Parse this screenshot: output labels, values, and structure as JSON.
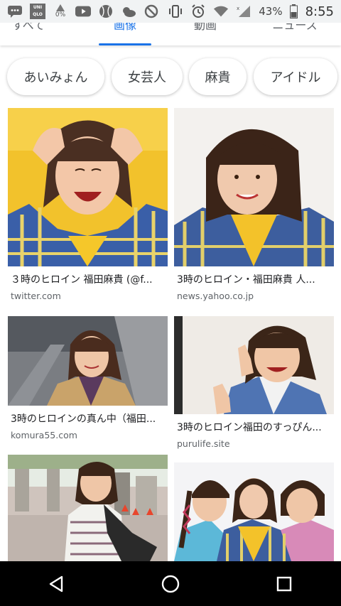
{
  "status_bar": {
    "brand_text": [
      "UNI",
      "QLO"
    ],
    "small_percent": "0%",
    "battery_percent": "43%",
    "time": "8:55",
    "icons": [
      "message-icon",
      "uniqlo-icon",
      "youtube-icon",
      "baseball-icon",
      "weather-icon",
      "blocked-icon",
      "vibrate-icon",
      "alarm-icon",
      "wifi-icon",
      "signal-icon",
      "battery-icon"
    ]
  },
  "tabs": {
    "items": [
      "すべて",
      "画像",
      "動画",
      "ニュース"
    ],
    "active_index": 1
  },
  "chips": [
    "あいみょん",
    "女芸人",
    "麻貴",
    "アイドル"
  ],
  "results": [
    {
      "caption": "３時のヒロイン 福田麻貴 (@f...",
      "domain": "twitter.com"
    },
    {
      "caption": "3時のヒロイン・福田麻貴 人...",
      "domain": "news.yahoo.co.jp"
    },
    {
      "caption": "3時のヒロインの真ん中（福田...",
      "domain": "komura55.com"
    },
    {
      "caption": "3時のヒロイン福田のすっぴん...",
      "domain": "purulife.site"
    }
  ],
  "nav": {
    "icons": [
      "back-icon",
      "home-icon",
      "recents-icon"
    ]
  },
  "colors": {
    "accent": "#1a73e8",
    "yellow_bg": "#f5c430",
    "plaid_blue": "#3a5fa8",
    "navbar": "#000000"
  }
}
